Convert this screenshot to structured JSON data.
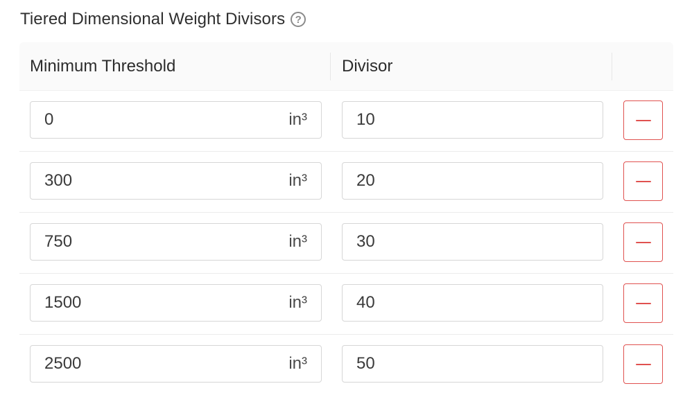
{
  "header": {
    "title": "Tiered Dimensional Weight Divisors",
    "help_icon": "question-circle-icon"
  },
  "table": {
    "columns": [
      "Minimum Threshold",
      "Divisor",
      ""
    ],
    "rows": [
      {
        "threshold": "0",
        "unit": "in³",
        "divisor": "10"
      },
      {
        "threshold": "300",
        "unit": "in³",
        "divisor": "20"
      },
      {
        "threshold": "750",
        "unit": "in³",
        "divisor": "30"
      },
      {
        "threshold": "1500",
        "unit": "in³",
        "divisor": "40"
      },
      {
        "threshold": "2500",
        "unit": "in³",
        "divisor": "50"
      }
    ],
    "remove_icon": "minus-icon"
  },
  "colors": {
    "danger": "#e0514f",
    "header_bg": "#fafafa",
    "border": "#d6d6d6"
  }
}
